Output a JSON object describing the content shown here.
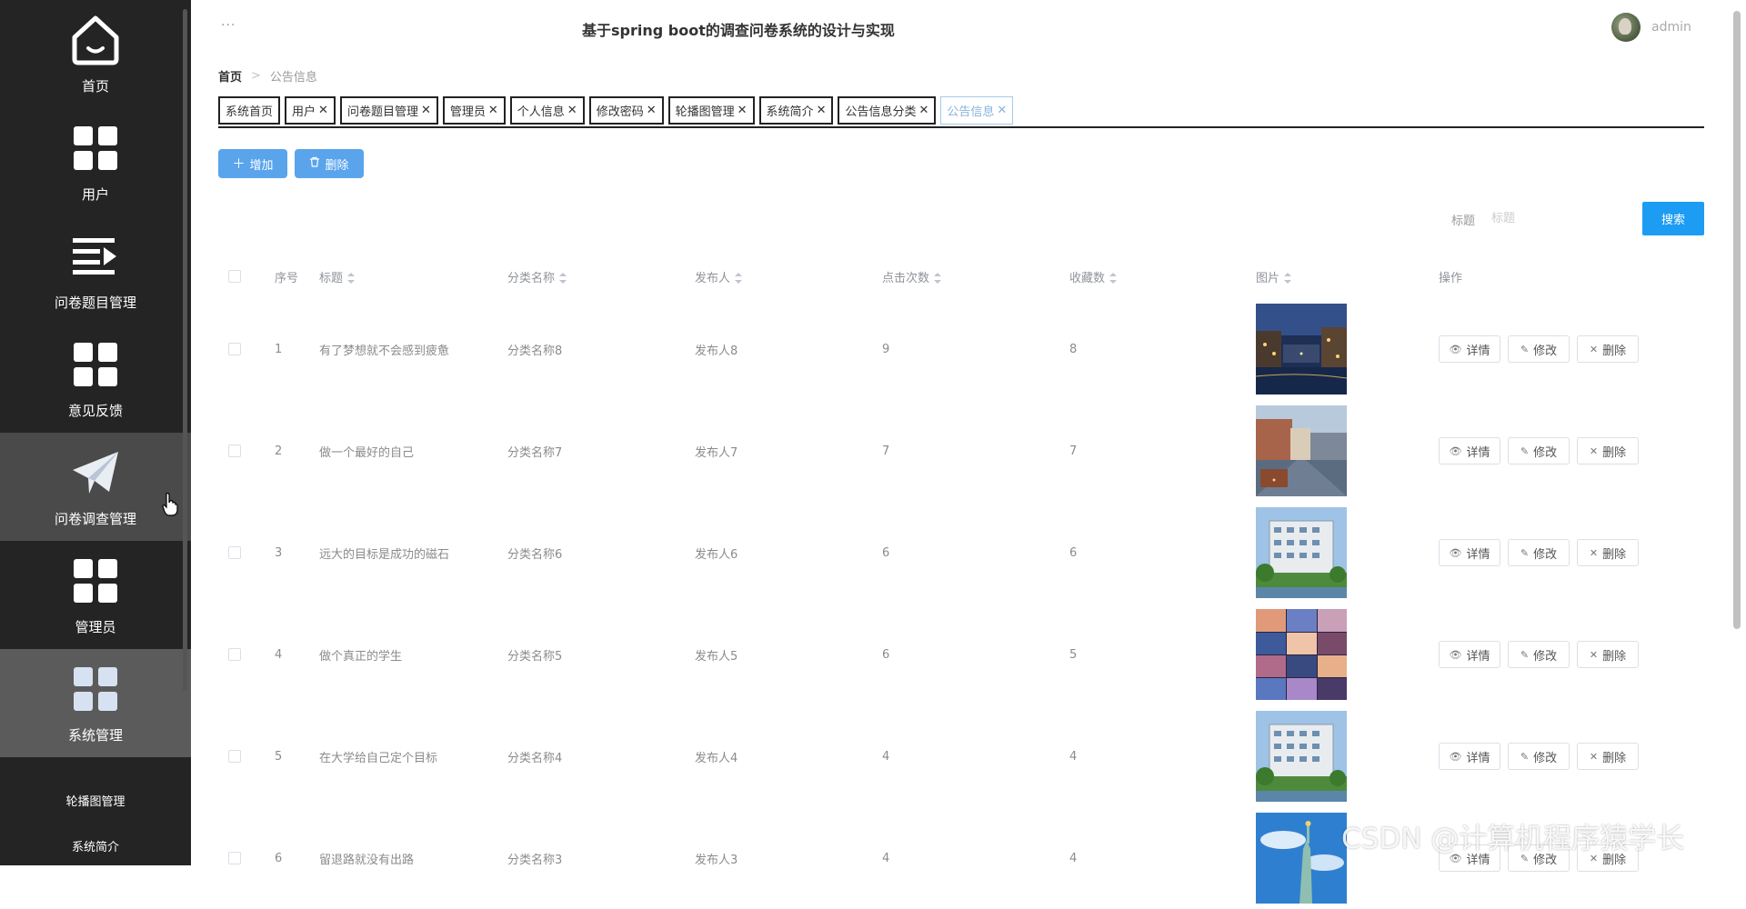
{
  "app": {
    "title": "基于spring boot的调查问卷系统的设计与实现",
    "more": "···",
    "user_name": "admin"
  },
  "sidebar": {
    "items": [
      {
        "label": "首页",
        "icon": "home-icon"
      },
      {
        "label": "用户",
        "icon": "grid-icon"
      },
      {
        "label": "问卷题目管理",
        "icon": "list-arrow-icon"
      },
      {
        "label": "意见反馈",
        "icon": "grid-icon"
      },
      {
        "label": "问卷调查管理",
        "icon": "paper-plane-icon"
      },
      {
        "label": "管理员",
        "icon": "grid-icon"
      },
      {
        "label": "系统管理",
        "icon": "grid-icon"
      }
    ],
    "sub_items": [
      {
        "label": "轮播图管理"
      },
      {
        "label": "系统简介"
      }
    ]
  },
  "breadcrumb": {
    "home": "首页",
    "current": "公告信息"
  },
  "tags": [
    {
      "label": "系统首页",
      "closable": false
    },
    {
      "label": "用户",
      "closable": true
    },
    {
      "label": "问卷题目管理",
      "closable": true
    },
    {
      "label": "管理员",
      "closable": true
    },
    {
      "label": "个人信息",
      "closable": true
    },
    {
      "label": "修改密码",
      "closable": true
    },
    {
      "label": "轮播图管理",
      "closable": true
    },
    {
      "label": "系统简介",
      "closable": true
    },
    {
      "label": "公告信息分类",
      "closable": true
    },
    {
      "label": "公告信息",
      "closable": true,
      "active": true
    }
  ],
  "toolbar": {
    "add_label": "增加",
    "delete_label": "删除"
  },
  "search": {
    "label": "标题",
    "placeholder": "标题",
    "button_label": "搜索"
  },
  "table": {
    "columns": [
      "序号",
      "标题",
      "分类名称",
      "发布人",
      "点击次数",
      "收藏数",
      "图片",
      "操作"
    ],
    "rows": [
      {
        "index": "1",
        "title": "有了梦想就不会感到疲惫",
        "category": "分类名称8",
        "publisher": "发布人8",
        "clicks": "9",
        "favorites": "8",
        "image": "night-canal"
      },
      {
        "index": "2",
        "title": "做一个最好的自己",
        "category": "分类名称7",
        "publisher": "发布人7",
        "clicks": "7",
        "favorites": "7",
        "image": "city-street"
      },
      {
        "index": "3",
        "title": "远大的目标是成功的磁石",
        "category": "分类名称6",
        "publisher": "发布人6",
        "clicks": "6",
        "favorites": "6",
        "image": "apartment-building"
      },
      {
        "index": "4",
        "title": "做个真正的学生",
        "category": "分类名称5",
        "publisher": "发布人5",
        "clicks": "6",
        "favorites": "5",
        "image": "photo-collage"
      },
      {
        "index": "5",
        "title": "在大学给自己定个目标",
        "category": "分类名称4",
        "publisher": "发布人4",
        "clicks": "4",
        "favorites": "4",
        "image": "apartment-building"
      },
      {
        "index": "6",
        "title": "留退路就没有出路",
        "category": "分类名称3",
        "publisher": "发布人3",
        "clicks": "4",
        "favorites": "4",
        "image": "statue-of-liberty"
      }
    ],
    "actions": {
      "detail": "详情",
      "edit": "修改",
      "delete": "删除"
    }
  },
  "watermark": "CSDN @计算机程序猿学长",
  "colors": {
    "sidebar_bg": "#242424",
    "primary_button": "#5aa4ec",
    "search_button": "#1c9cf3"
  }
}
